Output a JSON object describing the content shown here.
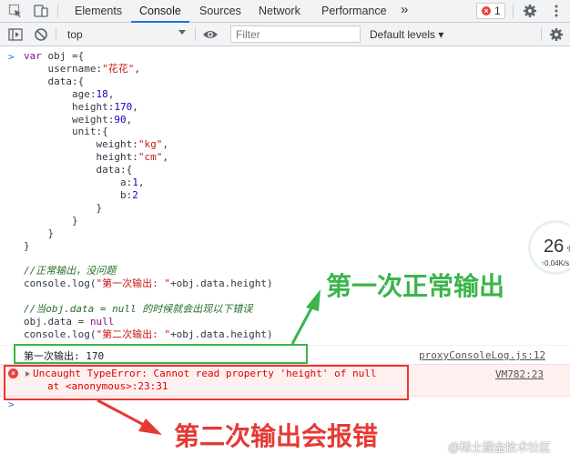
{
  "tabs": [
    {
      "label": "Elements"
    },
    {
      "label": "Console",
      "active": true
    },
    {
      "label": "Sources"
    },
    {
      "label": "Network"
    },
    {
      "label": "Performance"
    }
  ],
  "more_tabs_glyph": "»",
  "error_badge": {
    "count": "1",
    "icon_glyph": "×"
  },
  "toolbar": {
    "context": "top",
    "filter_placeholder": "Filter",
    "levels": "Default levels ▾"
  },
  "prompt_glyph": ">",
  "code_lines": [
    "var obj ={",
    "    username:\"花花\",",
    "    data:{",
    "        age:18,",
    "        height:170,",
    "        weight:90,",
    "        unit:{",
    "            weight:\"kg\",",
    "            height:\"cm\",",
    "            data:{",
    "                a:1,",
    "                b:2",
    "            }",
    "        }",
    "    }",
    "}",
    "",
    "//正常输出，没问题",
    "console.log(\"第一次输出: \"+obj.data.height)",
    "",
    "//当obj.data = null 的时候就会出现以下错误",
    "obj.data = null",
    "console.log(\"第二次输出: \"+obj.data.height)"
  ],
  "log_output": {
    "text": "第一次输出: 170",
    "source": "proxyConsoleLog.js:12"
  },
  "error_output": {
    "message": "Uncaught TypeError: Cannot read property 'height' of null",
    "stack": "at <anonymous>:23:31",
    "source": "VM782:23"
  },
  "annotations": {
    "first": "第一次正常输出",
    "second": "第二次输出会报错"
  },
  "perf_widget": {
    "value": "26",
    "unit": "%",
    "speed": "0.04K/s",
    "speed_arrow": "↑"
  },
  "watermark": "@稀土掘金技术社区",
  "colors": {
    "accent": "#1a73e8",
    "error": "#e53935",
    "annotation_green": "#3bb54a",
    "error_bg": "#fff0f0"
  }
}
